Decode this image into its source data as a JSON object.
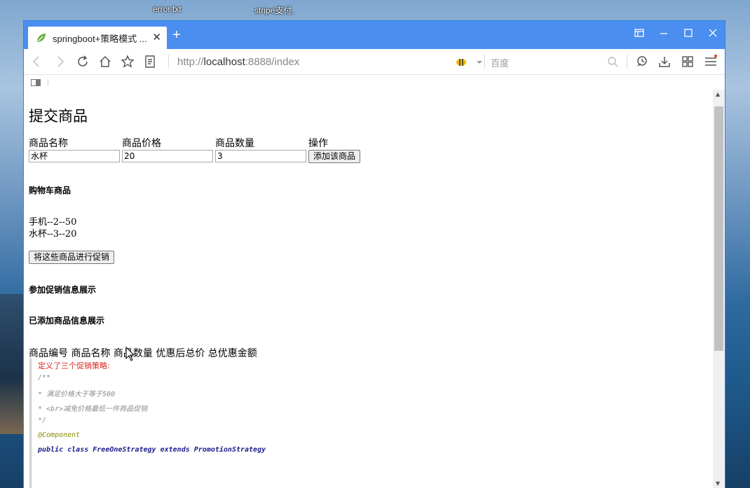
{
  "desktop": {
    "icons": [
      "error.txt",
      "stripe支付,"
    ]
  },
  "browser": {
    "tab_title": "springboot+策略模式 ...",
    "url_prefix": "http://",
    "url_host": "localhost",
    "url_rest": ":8888/index",
    "search_placeholder": "百度"
  },
  "page": {
    "title": "提交商品",
    "form": {
      "headers": [
        "商品名称",
        "商品价格",
        "商品数量",
        "操作"
      ],
      "values": [
        "水杯",
        "20",
        "3"
      ],
      "add_button": "添加该商品"
    },
    "cart_heading": "购物车商品",
    "cart_items": [
      "手机--2--50",
      "水杯--3--20"
    ],
    "promo_button": "将这些商品进行促销",
    "promo_info_heading": "参加促销信息展示",
    "added_info_heading": "已添加商品信息展示",
    "table_columns": "商品编号 商品名称 商品数量 优惠后总价 总优惠金额"
  },
  "code_overlay": {
    "label": "定义了三个促销策略:",
    "lines": [
      "/**",
      " * 满足价格大于等于500",
      " * <br>减免价格最低一件商品促销",
      " */",
      "@Component",
      "public class FreeOneStrategy extends PromotionStrategy"
    ]
  },
  "colors": {
    "titlebar": "#4a8ef0",
    "accent_red": "#e02020"
  }
}
